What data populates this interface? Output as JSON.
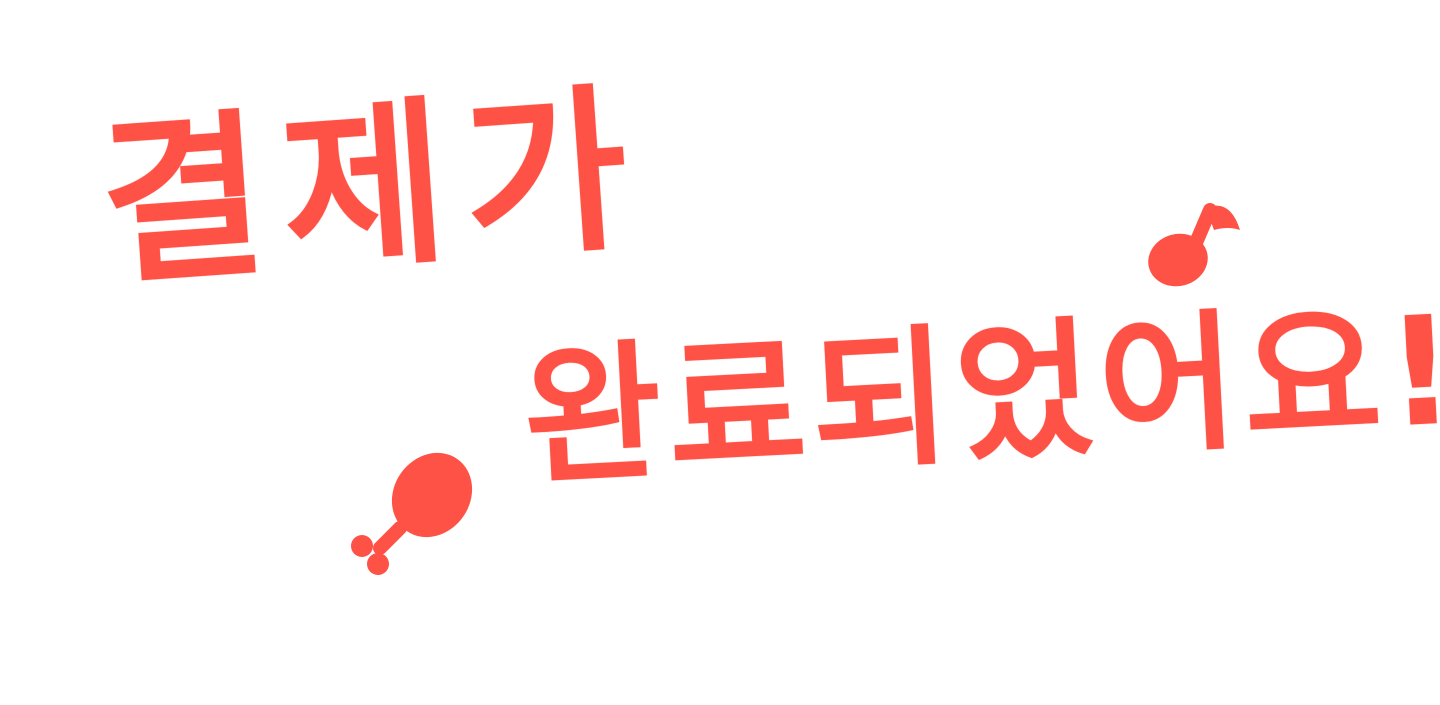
{
  "message": {
    "line1": "결제가",
    "line2": "완료되었어요!"
  },
  "decorations": {
    "top_icon": "music-note-icon",
    "bottom_icon": "drumstick-icon"
  },
  "colors": {
    "ink": "#FF5246",
    "background": "#FFFFFF"
  }
}
